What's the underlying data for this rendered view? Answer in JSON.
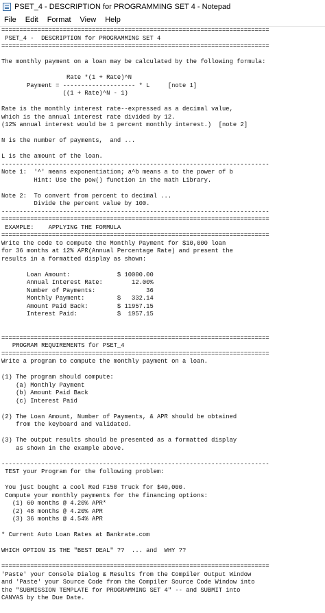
{
  "window": {
    "title": "PSET_4 - DESCRIPTION for PROGRAMMING SET 4 - Notepad"
  },
  "menu": {
    "items": [
      "File",
      "Edit",
      "Format",
      "View",
      "Help"
    ]
  },
  "document": {
    "lines": [
      "==========================================================================",
      " PSET_4 -  DESCRIPTION for PROGRAMMING SET 4",
      "==========================================================================",
      "",
      "The monthly payment on a loan may be calculated by the following formula:",
      "",
      "                  Rate *(1 + Rate)^N",
      "       Payment = -------------------- * L     [note 1]",
      "                 ((1 + Rate)^N - 1)",
      "",
      "Rate is the monthly interest rate--expressed as a decimal value,",
      "which is the annual interest rate divided by 12.",
      "(12% annual interest would be 1 percent monthly interest.)  [note 2]",
      "",
      "N is the number of payments,  and ...",
      "",
      "L is the amount of the loan.",
      "--------------------------------------------------------------------------",
      "Note 1:  '^' means exponentiation; a^b means a to the power of b",
      "         Hint: Use the pow() function in the math Library.",
      "",
      "Note 2:  To convert from percent to decimal ...",
      "         Divide the percent value by 100.",
      "--------------------------------------------------------------------------",
      "==========================================================================",
      " EXAMPLE:    APPLYING THE FORMULA",
      "==========================================================================",
      "Write the code to compute the Monthly Payment for $10,000 loan",
      "for 36 months at 12% APR(Annual Percentage Rate) and present the",
      "results in a formatted display as shown:",
      "",
      "       Loan Amount:             $ 10000.00",
      "       Annual Interest Rate:        12.00%",
      "       Number of Payments:              36",
      "       Monthly Payment:         $   332.14",
      "       Amount Paid Back:        $ 11957.15",
      "       Interest Paid:           $  1957.15",
      "",
      "",
      "==========================================================================",
      "   PROGRAM REQUIREMENTS for PSET_4",
      "==========================================================================",
      "Write a program to compute the monthly payment on a loan.",
      "",
      "(1) The program should compute:",
      "    (a) Monthly Payment",
      "    (b) Amount Paid Back",
      "    (c) Interest Paid",
      "",
      "(2) The Loan Amount, Number of Payments, & APR should be obtained",
      "    from the keyboard and validated.",
      "",
      "(3) The output results should be presented as a formatted display",
      "    as shown in the example above.",
      "",
      "--------------------------------------------------------------------------",
      " TEST your Program for the following problem:",
      "",
      " You just bought a cool Red F150 Truck for $40,000.",
      " Compute your monthly payments for the financing options:",
      "   (1) 60 months @ 4.20% APR*",
      "   (2) 48 months @ 4.20% APR",
      "   (3) 36 months @ 4.54% APR",
      "",
      "* Current Auto Loan Rates at Bankrate.com",
      "",
      "WHICH OPTION IS THE \"BEST DEAL\" ??  ... and  WHY ??",
      "",
      "==========================================================================",
      "'Paste' your Console Dialog & Results from the Compiler Output Window",
      "and 'Paste' your Source Code from the Compiler Source Code Window into",
      "the \"SUBMISSION TEMPLATE for PROGRAMMING SET 4\" -- and SUBMIT into",
      "CANVAS by the Due Date."
    ]
  }
}
